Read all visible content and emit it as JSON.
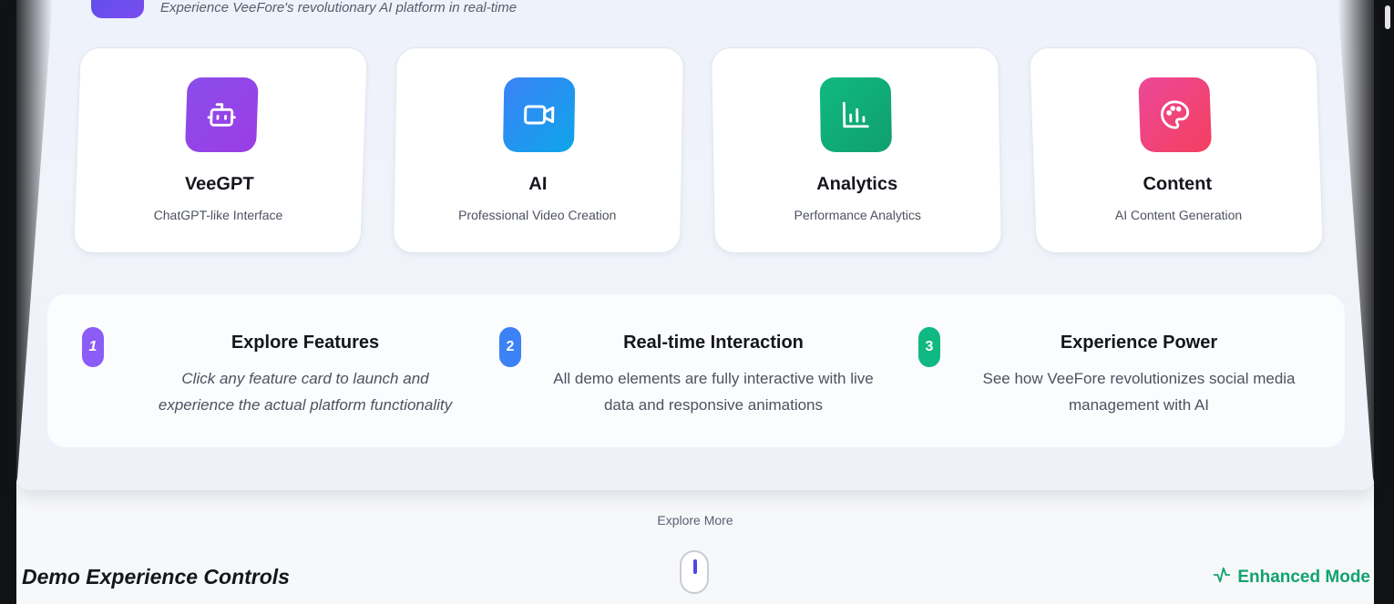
{
  "hero": {
    "subtitle": "Experience VeeFore's revolutionary AI platform in real-time"
  },
  "features": [
    {
      "title": "VeeGPT",
      "desc": "ChatGPT-like Interface",
      "icon": "bot-icon",
      "colors": [
        "#8a4dea",
        "#9b3de6"
      ]
    },
    {
      "title": "AI",
      "desc": "Professional Video Creation",
      "icon": "video-icon",
      "colors": [
        "#3b82f6",
        "#0ea5e9"
      ]
    },
    {
      "title": "Analytics",
      "desc": "Performance Analytics",
      "icon": "bar-chart-icon",
      "colors": [
        "#10b981",
        "#0f9f6e"
      ]
    },
    {
      "title": "Content",
      "desc": "AI Content Generation",
      "icon": "palette-icon",
      "colors": [
        "#ec4899",
        "#f43f5e"
      ]
    }
  ],
  "steps": [
    {
      "num": "1",
      "title": "Explore Features",
      "desc_line1": "Click any feature card to launch and",
      "desc_line2": "experience the actual platform functionality",
      "color": "#8b5cf6"
    },
    {
      "num": "2",
      "title": "Real-time Interaction",
      "desc_line1": "All demo elements are fully interactive with live",
      "desc_line2": "data and responsive animations",
      "color": "#3b82f6"
    },
    {
      "num": "3",
      "title": "Experience Power",
      "desc_line1": "See how VeeFore revolutionizes social media",
      "desc_line2": "management with AI",
      "color": "#10b981"
    }
  ],
  "explore_more": "Explore More",
  "controls": {
    "title": "Demo Experience Controls",
    "mode_label": "Enhanced Mode",
    "mode_icon": "activity-icon"
  }
}
